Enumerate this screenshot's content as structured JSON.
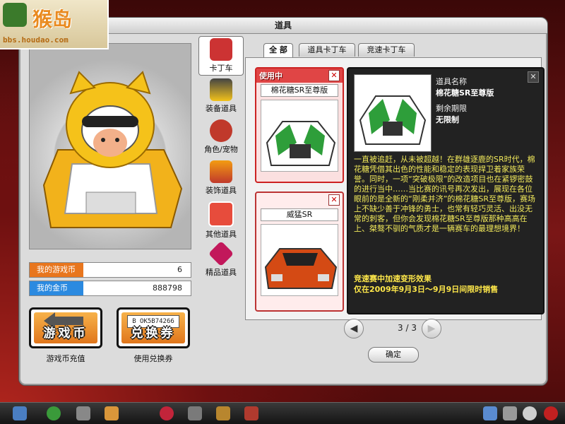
{
  "logo": {
    "title": "猴岛",
    "url": "bbs.houdao.com"
  },
  "window": {
    "title": "道具"
  },
  "currency": {
    "game_coin_label": "我的游戏币",
    "game_coin_value": "6",
    "gold_label": "我的金币",
    "gold_value": "888798",
    "game_coin_color": "#e8761e",
    "gold_color": "#2b8ae0"
  },
  "buttons": {
    "recharge_label": "游戏币",
    "recharge_caption": "游戏币充值",
    "voucher_label": "兑换券",
    "voucher_caption": "使用兑换券",
    "voucher_code": "B OK5B74266"
  },
  "categories": [
    {
      "label": "卡丁车",
      "icon": "kart-icon",
      "active": true
    },
    {
      "label": "装备道具",
      "icon": "goggles-icon"
    },
    {
      "label": "角色/宠物",
      "icon": "monkey-icon"
    },
    {
      "label": "装饰道具",
      "icon": "flame-icon"
    },
    {
      "label": "其他道具",
      "icon": "giftbox-icon"
    },
    {
      "label": "精品道具",
      "icon": "gem-icon"
    }
  ],
  "tabs": [
    {
      "label": "全 部",
      "active": true
    },
    {
      "label": "道具卡丁车"
    },
    {
      "label": "竞速卡丁车"
    }
  ],
  "items": [
    {
      "status": "使用中",
      "name": "棉花糖SR至尊版",
      "close": "✕"
    },
    {
      "status": "",
      "name": "威猛SR",
      "close": "✕"
    }
  ],
  "detail": {
    "name_label": "道具名称",
    "name_value": "棉花糖SR至尊版",
    "expire_label": "剩余期限",
    "expire_value": "无限制",
    "description": "一直被追赶，从未被超越！在群雄逐鹿的SR时代，棉花糖凭借其出色的性能和稳定的表现捍卫着家族荣誉。同时，一项“突破极限”的改造项目也在紧锣密鼓的进行当中……当比赛的讯号再次发出，展现在各位眼前的是全新的“刚柔并济”的棉花糖SR至尊版，赛场上不缺少善于冲锋的勇士，也常有轻巧灵活、出没无常的刺客，但你会发现棉花糖SR至尊版那种高高在上、桀骜不驯的气质才是一辆赛车的最理想境界！",
    "promo_line1": "竞速赛中加速变形效果",
    "promo_line2": "仅在2009年9月3日～9月9日间限时销售",
    "close": "✕"
  },
  "pager": {
    "current": "3",
    "separator": "/",
    "total": "3",
    "prev": "◀",
    "next": "▶"
  },
  "ok_label": "确定",
  "taskbar_icons": [
    "app-icon",
    "refresh-icon",
    "cart-icon",
    "character-icon",
    "heart-icon",
    "pen-icon",
    "shoe-icon",
    "book-icon",
    "kart-icon",
    "tools-icon",
    "search-icon",
    "power-icon"
  ]
}
